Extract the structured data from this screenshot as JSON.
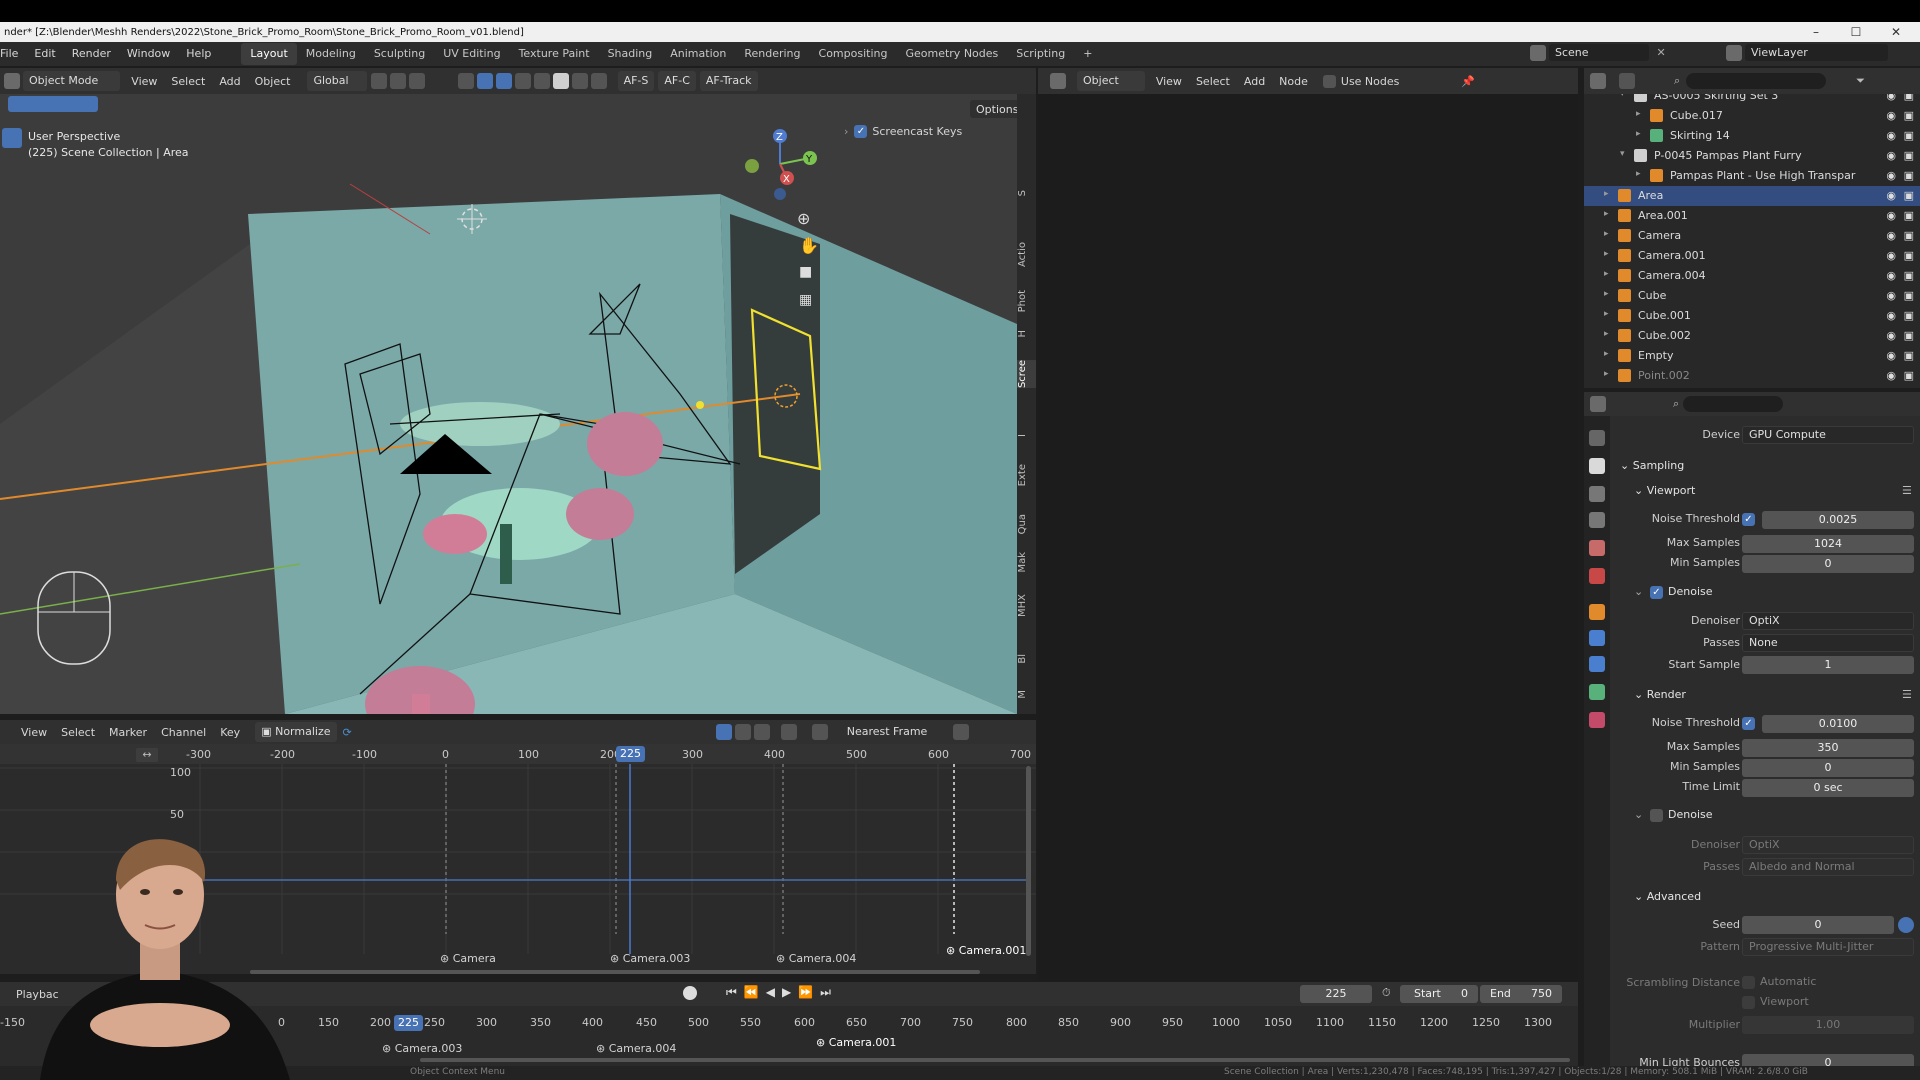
{
  "window": {
    "title": "nder* [Z:\\Blender\\Meshh Renders\\2022\\Stone_Brick_Promo_Room\\Stone_Brick_Promo_Room_v01.blend]"
  },
  "menu": [
    "File",
    "Edit",
    "Render",
    "Window",
    "Help"
  ],
  "workspaces": [
    "Layout",
    "Modeling",
    "Sculpting",
    "UV Editing",
    "Texture Paint",
    "Shading",
    "Animation",
    "Rendering",
    "Compositing",
    "Geometry Nodes",
    "Scripting"
  ],
  "workspace_add": "+",
  "scene": {
    "name": "Scene",
    "view_layer": "ViewLayer"
  },
  "viewport_header": {
    "mode": "Object Mode",
    "menus": [
      "View",
      "Select",
      "Add",
      "Object"
    ],
    "orientation": "Global",
    "af_s": "AF-S",
    "af_c": "AF-C",
    "af_track": "AF-Track",
    "options": "Options"
  },
  "viewport": {
    "perspective": "User Perspective",
    "collection": "(225) Scene Collection | Area",
    "screencast_keys": "Screencast Keys",
    "npanel_tabs": [
      "S",
      "Actio",
      "Phot",
      "H",
      "Scree",
      "I",
      "Exte",
      "Qua",
      "Mak",
      "MHX",
      "Bl",
      "M"
    ]
  },
  "node_header": {
    "type": "Object",
    "menus": [
      "View",
      "Select",
      "Add",
      "Node"
    ],
    "use_nodes": "Use Nodes"
  },
  "outliner": {
    "rows": [
      {
        "name": "AS-0005 Skirting Set 3",
        "indent": 2,
        "icon": "collection"
      },
      {
        "name": "Cube.017",
        "indent": 3,
        "icon": "mesh"
      },
      {
        "name": "Skirting 14",
        "indent": 3,
        "icon": "curve"
      },
      {
        "name": "P-0045 Pampas Plant Furry",
        "indent": 2,
        "icon": "collection"
      },
      {
        "name": "Pampas Plant - Use High Transpar",
        "indent": 3,
        "icon": "mesh"
      },
      {
        "name": "Area",
        "indent": 1,
        "icon": "light",
        "selected": true
      },
      {
        "name": "Area.001",
        "indent": 1,
        "icon": "light"
      },
      {
        "name": "Camera",
        "indent": 1,
        "icon": "camera"
      },
      {
        "name": "Camera.001",
        "indent": 1,
        "icon": "camera"
      },
      {
        "name": "Camera.004",
        "indent": 1,
        "icon": "camera"
      },
      {
        "name": "Cube",
        "indent": 1,
        "icon": "mesh"
      },
      {
        "name": "Cube.001",
        "indent": 1,
        "icon": "mesh"
      },
      {
        "name": "Cube.002",
        "indent": 1,
        "icon": "mesh"
      },
      {
        "name": "Empty",
        "indent": 1,
        "icon": "empty"
      },
      {
        "name": "Point.002",
        "indent": 1,
        "icon": "light",
        "dim": true
      }
    ]
  },
  "properties": {
    "device_label": "Device",
    "device_value": "GPU Compute",
    "sampling": "Sampling",
    "viewport": "Viewport",
    "noise_threshold_label": "Noise Threshold",
    "vp_noise_threshold": "0.0025",
    "max_samples_label": "Max Samples",
    "vp_max_samples": "1024",
    "min_samples_label": "Min Samples",
    "vp_min_samples": "0",
    "denoise": "Denoise",
    "denoiser_label": "Denoiser",
    "denoiser_value": "OptiX",
    "passes_label": "Passes",
    "vp_passes_value": "None",
    "start_sample_label": "Start Sample",
    "start_sample": "1",
    "render": "Render",
    "r_noise_threshold": "0.0100",
    "r_max_samples": "350",
    "r_min_samples": "0",
    "time_limit_label": "Time Limit",
    "time_limit": "0 sec",
    "r_denoiser_value": "OptiX",
    "r_passes_value": "Albedo and Normal",
    "advanced": "Advanced",
    "seed_label": "Seed",
    "seed": "0",
    "pattern_label": "Pattern",
    "pattern_value": "Progressive Multi-Jitter",
    "scrambling_label": "Scrambling Distance",
    "automatic": "Automatic",
    "viewport_opt": "Viewport",
    "multiplier_label": "Multiplier",
    "multiplier": "1.00",
    "min_light_bounces_label": "Min Light Bounces",
    "min_light_bounces": "0"
  },
  "graph": {
    "menus": [
      "View",
      "Select",
      "Marker",
      "Channel",
      "Key"
    ],
    "normalize": "Normalize",
    "snap": "Nearest Frame",
    "x_ticks": [
      "-300",
      "-200",
      "-100",
      "0",
      "100",
      "200",
      "300",
      "400",
      "500",
      "600",
      "700"
    ],
    "y_ticks": [
      "100",
      "50"
    ],
    "current_frame": "225",
    "markers": [
      "Camera",
      "Camera.003",
      "Camera.004",
      "Camera.001"
    ]
  },
  "timeline": {
    "playback": "Playbac",
    "current_frame": "225",
    "start_label": "Start",
    "start": "0",
    "end_label": "End",
    "end": "750",
    "ticks": [
      "-150",
      "0",
      "150",
      "200",
      "250",
      "300",
      "350",
      "400",
      "450",
      "500",
      "550",
      "600",
      "650",
      "700",
      "750",
      "800",
      "850",
      "900",
      "950",
      "1000",
      "1050",
      "1100",
      "1150",
      "1200",
      "1250",
      "1300"
    ],
    "current_badge": "225",
    "markers": [
      "Camera.003",
      "Camera.004",
      "Camera.001"
    ]
  },
  "status": {
    "context": "Object Context Menu",
    "stats": "Scene Collection | Area | Verts:1,230,478 | Faces:748,195 | Tris:1,397,427 | Objects:1/28 | Memory: 508.1 MiB | VRAM: 2.6/8.0 GiB"
  },
  "colors": {
    "accent": "#4772b3",
    "selection": "#334d80",
    "selected_light_outline": "#f0e030",
    "wall": "#7fb0b0"
  }
}
